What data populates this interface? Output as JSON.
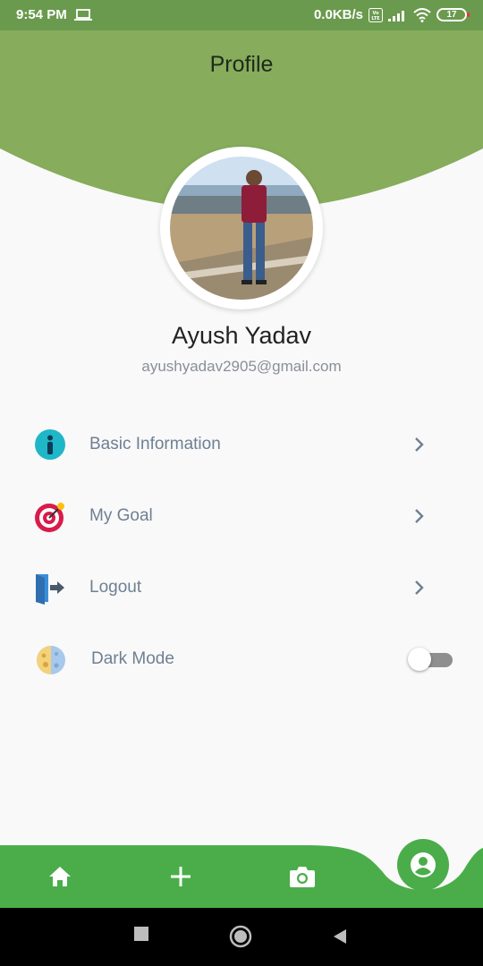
{
  "status_bar": {
    "time": "9:54 PM",
    "network_speed": "0.0KB/s",
    "volte": "VoLTE",
    "battery": "17"
  },
  "page": {
    "title": "Profile"
  },
  "profile": {
    "name": "Ayush Yadav",
    "email": "ayushyadav2905@gmail.com",
    "avatar_icon": "profile-photo"
  },
  "menu": [
    {
      "label": "Basic Information",
      "icon": "info-icon"
    },
    {
      "label": "My Goal",
      "icon": "target-icon"
    },
    {
      "label": "Logout",
      "icon": "logout-icon"
    }
  ],
  "dark_mode": {
    "label": "Dark Mode",
    "enabled": false,
    "icon": "moon-icon"
  },
  "bottom_nav": {
    "items": [
      "home-icon",
      "plus-icon",
      "camera-icon",
      "person-icon"
    ],
    "active": "person-icon"
  },
  "colors": {
    "header_green": "#86ac5c",
    "status_green": "#6a9a4e",
    "nav_green": "#4aad4a",
    "text_muted": "#6f7f93"
  }
}
